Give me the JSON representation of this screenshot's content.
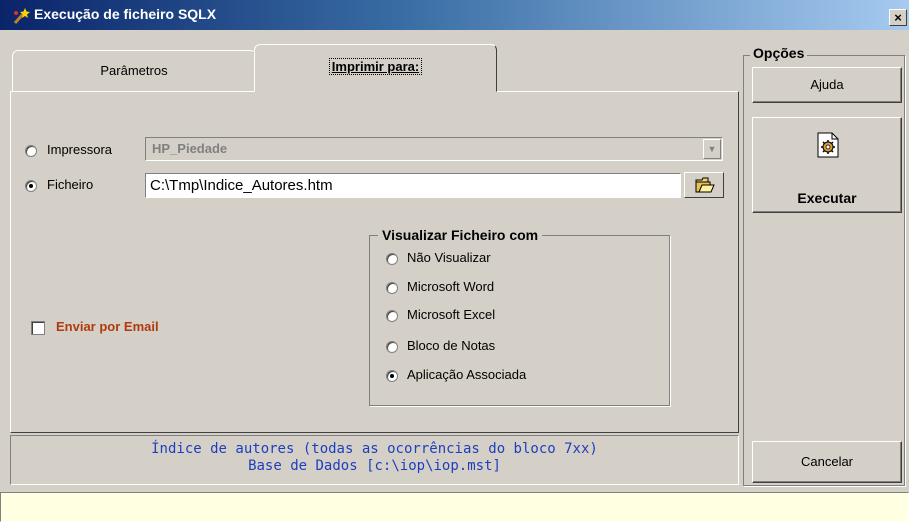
{
  "window": {
    "title": "Execução de ficheiro SQLX",
    "close_label": "×"
  },
  "tabs": [
    {
      "label": "Parâmetros",
      "active": false
    },
    {
      "label": "Imprimir para:",
      "active": true
    }
  ],
  "output": {
    "printer_label": "Impressora",
    "printer_value": "HP_Piedade",
    "printer_selected": false,
    "file_label": "Ficheiro",
    "file_value": "C:\\Tmp\\Indice_Autores.htm",
    "file_selected": true
  },
  "viewer": {
    "title": "Visualizar Ficheiro com",
    "options": [
      {
        "label": "Não Visualizar",
        "selected": false
      },
      {
        "label": "Microsoft Word",
        "selected": false
      },
      {
        "label": "Microsoft Excel",
        "selected": false
      },
      {
        "label": "Bloco de Notas",
        "selected": false
      },
      {
        "label": "Aplicação Associada",
        "selected": true
      }
    ]
  },
  "email": {
    "label": "Enviar por Email",
    "checked": false
  },
  "info": {
    "line1": "Índice de autores (todas as ocorrências do bloco 7xx)",
    "line2": "Base de Dados [c:\\iop\\iop.mst]"
  },
  "options_panel": {
    "title": "Opções",
    "help_label": "Ajuda",
    "execute_label": "Executar",
    "cancel_label": "Cancelar"
  },
  "colors": {
    "face": "#d4d0c8",
    "title_start": "#0a246a",
    "title_end": "#a6caf0",
    "info_text": "#1e3fbd",
    "email_text": "#b03a10",
    "status_bg": "#ffffe1"
  }
}
